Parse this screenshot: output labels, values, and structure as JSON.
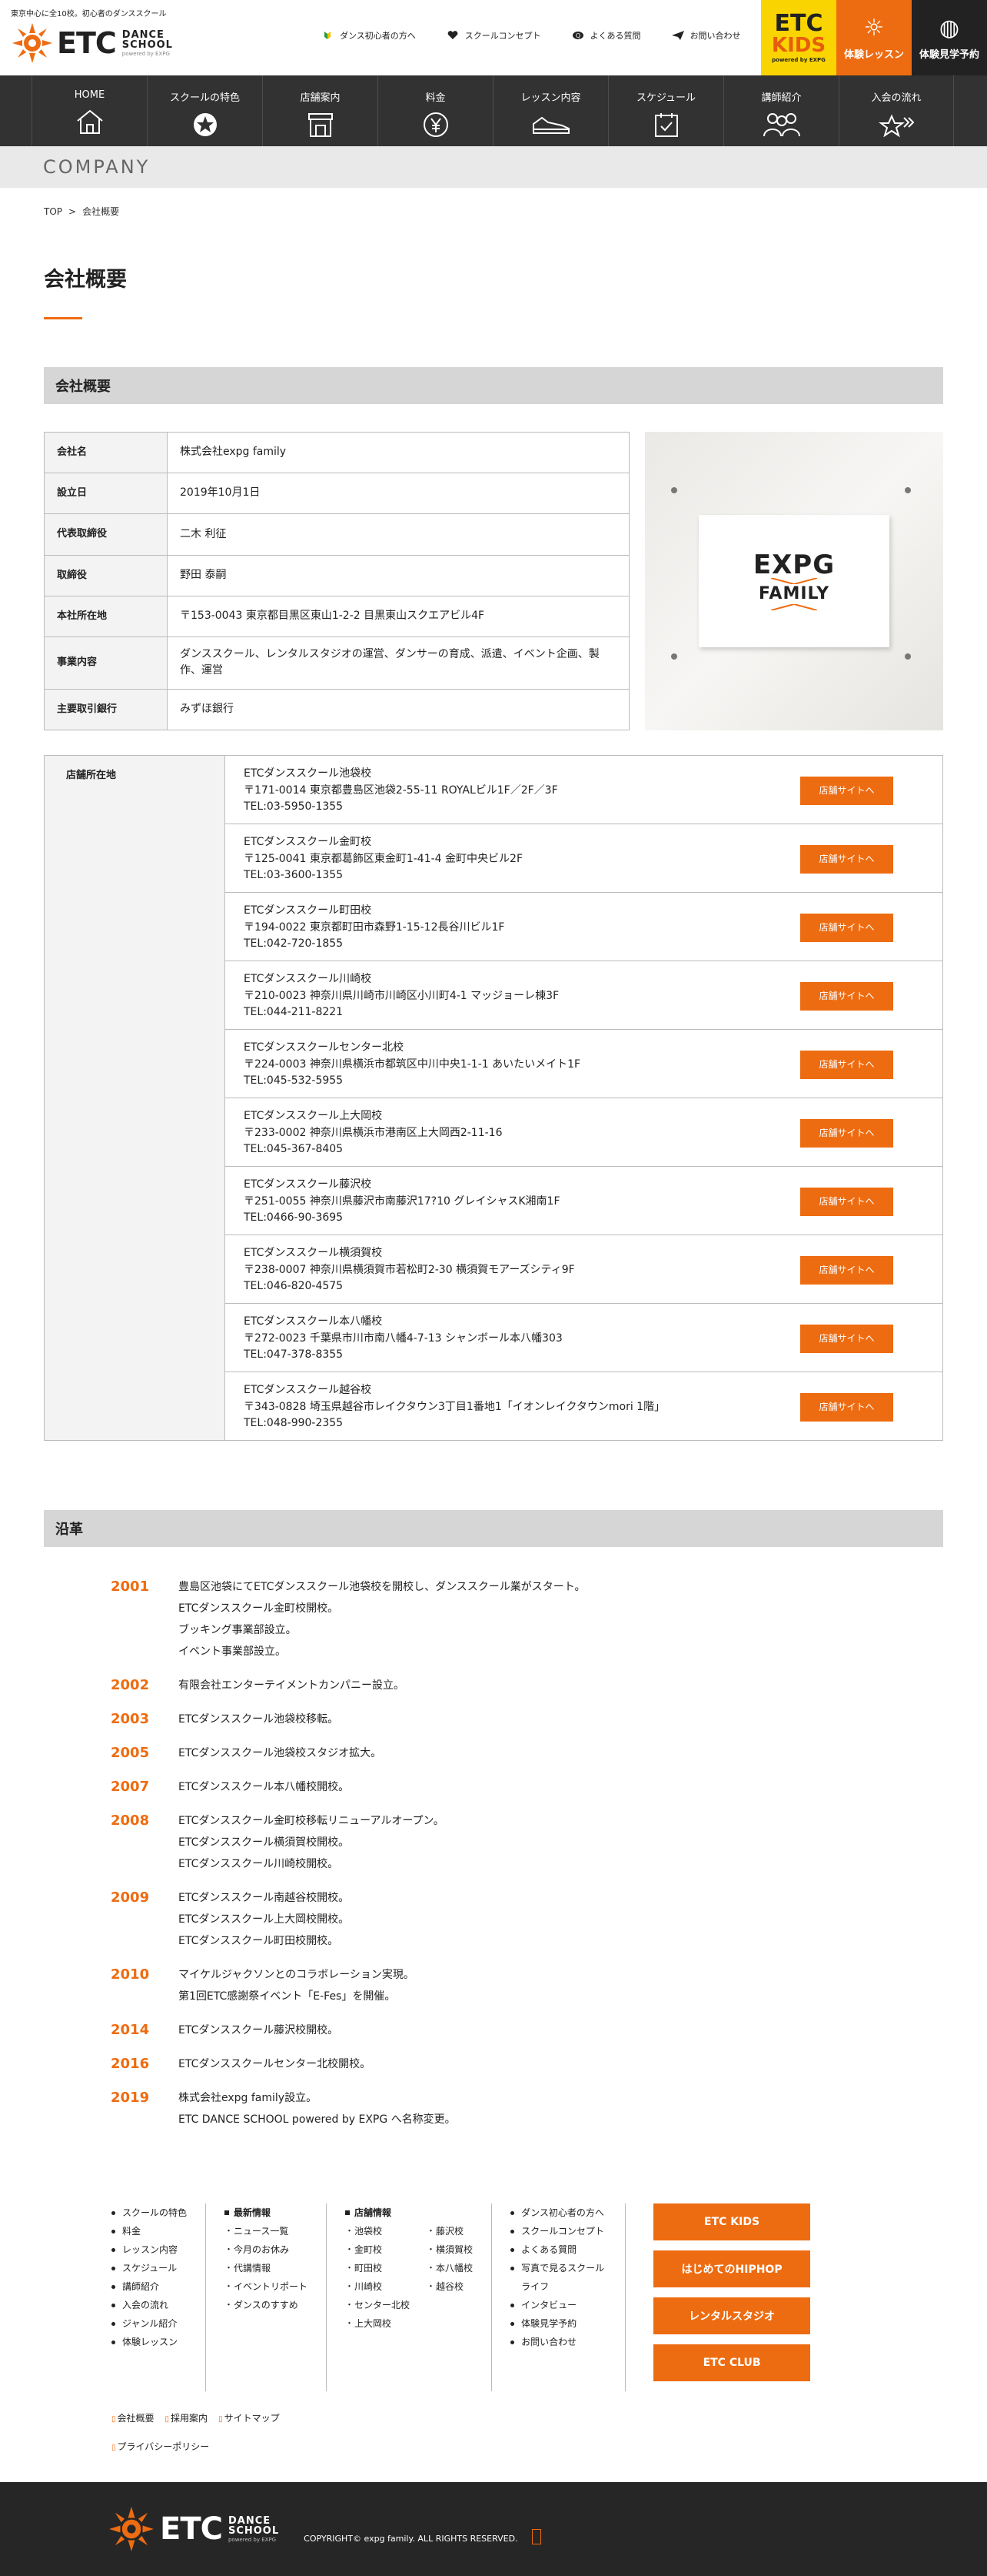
{
  "header": {
    "tagline": "東京中心に全10校。初心者のダンススクール",
    "logo_text": "ETC",
    "logo_sub1": "DANCE",
    "logo_sub2": "SCHOOL",
    "logo_sub3": "powered by EXPG",
    "top_nav": [
      {
        "label": "ダンス初心者の方へ",
        "icon": "beginner-mark-icon"
      },
      {
        "label": "スクールコンセプト",
        "icon": "heart-hands-icon"
      },
      {
        "label": "よくある質問",
        "icon": "question-bubble-icon"
      },
      {
        "label": "お問い合わせ",
        "icon": "paper-plane-icon"
      }
    ],
    "kids_line1": "ETC",
    "kids_line2": "KIDS",
    "kids_line3": "powered by EXPG",
    "trial_label": "体験レッスン",
    "visit_label": "体験見学予約"
  },
  "main_nav": [
    {
      "label": "HOME",
      "icon": "house-icon"
    },
    {
      "label": "スクールの特色",
      "icon": "badge-star-icon"
    },
    {
      "label": "店舗案内",
      "icon": "storefront-icon"
    },
    {
      "label": "料金",
      "icon": "yen-coin-icon"
    },
    {
      "label": "レッスン内容",
      "icon": "sneaker-icon"
    },
    {
      "label": "スケジュール",
      "icon": "calendar-check-icon"
    },
    {
      "label": "講師紹介",
      "icon": "people-icon"
    },
    {
      "label": "入会の流れ",
      "icon": "stars-flow-icon"
    }
  ],
  "band_title": "COMPANY",
  "breadcrumb": [
    "TOP",
    "会社概要"
  ],
  "page_title": "会社概要",
  "company_section_title": "会社概要",
  "company_info": [
    {
      "key": "会社名",
      "value": "株式会社expg family"
    },
    {
      "key": "設立日",
      "value": "2019年10月1日"
    },
    {
      "key": "代表取締役",
      "value": "二木 利征"
    },
    {
      "key": "取締役",
      "value": "野田 泰嗣"
    },
    {
      "key": "本社所在地",
      "value": "〒153-0043 東京都目黒区東山1-2-2 目黒東山スクエアビル4F"
    },
    {
      "key": "事業内容",
      "value": "ダンススクール、レンタルスタジオの運営、ダンサーの育成、派遣、イベント企画、製作、運営"
    },
    {
      "key": "主要取引銀行",
      "value": "みずほ銀行"
    }
  ],
  "sign": {
    "line1": "EXPG",
    "line2": "FAMILY"
  },
  "stores_key": "店舗所在地",
  "store_button_label": "店舗サイトへ",
  "stores": [
    {
      "name": "ETCダンススクール池袋校",
      "address": "〒171-0014 東京都豊島区池袋2-55-11 ROYALビル1F／2F／3F",
      "tel": "TEL:03-5950-1355"
    },
    {
      "name": "ETCダンススクール金町校",
      "address": "〒125-0041 東京都葛飾区東金町1-41-4 金町中央ビル2F",
      "tel": "TEL:03-3600-1355"
    },
    {
      "name": "ETCダンススクール町田校",
      "address": "〒194-0022 東京都町田市森野1-15-12長谷川ビル1F",
      "tel": "TEL:042-720-1855"
    },
    {
      "name": "ETCダンススクール川崎校",
      "address": "〒210-0023 神奈川県川崎市川崎区小川町4-1 マッジョーレ棟3F",
      "tel": "TEL:044-211-8221"
    },
    {
      "name": "ETCダンススクールセンター北校",
      "address": "〒224-0003 神奈川県横浜市都筑区中川中央1-1-1 あいたいメイト1F",
      "tel": "TEL:045-532-5955"
    },
    {
      "name": "ETCダンススクール上大岡校",
      "address": "〒233-0002 神奈川県横浜市港南区上大岡西2-11-16",
      "tel": "TEL:045-367-8405"
    },
    {
      "name": "ETCダンススクール藤沢校",
      "address": "〒251-0055 神奈川県藤沢市南藤沢17?10 グレイシャスK湘南1F",
      "tel": "TEL:0466-90-3695"
    },
    {
      "name": "ETCダンススクール横須賀校",
      "address": "〒238-0007 神奈川県横須賀市若松町2-30 横須賀モアーズシティ9F",
      "tel": "TEL:046-820-4575"
    },
    {
      "name": "ETCダンススクール本八幡校",
      "address": "〒272-0023 千葉県市川市南八幡4-7-13 シャンボール本八幡303",
      "tel": "TEL:047-378-8355"
    },
    {
      "name": "ETCダンススクール越谷校",
      "address": "〒343-0828 埼玉県越谷市レイクタウン3丁目1番地1「イオンレイクタウンmori 1階」",
      "tel": "TEL:048-990-2355"
    }
  ],
  "history_title": "沿革",
  "history": [
    {
      "year": "2001",
      "events": [
        "豊島区池袋にてETCダンススクール池袋校を開校し、ダンススクール業がスタート。",
        "ETCダンススクール金町校開校。",
        "ブッキング事業部設立。",
        "イベント事業部設立。"
      ]
    },
    {
      "year": "2002",
      "events": [
        "有限会社エンターテイメントカンパニー設立。"
      ]
    },
    {
      "year": "2003",
      "events": [
        "ETCダンススクール池袋校移転。"
      ]
    },
    {
      "year": "2005",
      "events": [
        "ETCダンススクール池袋校スタジオ拡大。"
      ]
    },
    {
      "year": "2007",
      "events": [
        "ETCダンススクール本八幡校開校。"
      ]
    },
    {
      "year": "2008",
      "events": [
        "ETCダンススクール金町校移転リニューアルオープン。",
        "ETCダンススクール横須賀校開校。",
        "ETCダンススクール川崎校開校。"
      ]
    },
    {
      "year": "2009",
      "events": [
        "ETCダンススクール南越谷校開校。",
        "ETCダンススクール上大岡校開校。",
        "ETCダンススクール町田校開校。"
      ]
    },
    {
      "year": "2010",
      "events": [
        "マイケルジャクソンとのコラボレーション実現。",
        "第1回ETC感謝祭イベント「E-Fes」を開催。"
      ]
    },
    {
      "year": "2014",
      "events": [
        "ETCダンススクール藤沢校開校。"
      ]
    },
    {
      "year": "2016",
      "events": [
        "ETCダンススクールセンター北校開校。"
      ]
    },
    {
      "year": "2019",
      "events": [
        "株式会社expg family設立。",
        "ETC DANCE SCHOOL powered by EXPG へ名称変更。"
      ]
    }
  ],
  "footer": {
    "col1": [
      "スクールの特色",
      "料金",
      "レッスン内容",
      "スケジュール",
      "講師紹介",
      "入会の流れ",
      "ジャンル紹介",
      "体験レッスン"
    ],
    "col2_title": "最新情報",
    "col2": [
      "ニュース一覧",
      "今月のお休み",
      "代講情報",
      "イベントリポート",
      "ダンスのすすめ"
    ],
    "col3_title": "店舗情報",
    "col3a": [
      "池袋校",
      "金町校",
      "町田校",
      "川崎校",
      "センター北校",
      "上大岡校"
    ],
    "col3b": [
      "藤沢校",
      "横須賀校",
      "本八幡校",
      "越谷校"
    ],
    "col4": [
      "ダンス初心者の方へ",
      "スクールコンセプト",
      "よくある質問",
      "写真で見るスクールライフ",
      "インタビュー",
      "体験見学予約",
      "お問い合わせ"
    ],
    "buttons": [
      "ETC KIDS",
      "はじめてのHIPHOP",
      "レンタルスタジオ",
      "ETC CLUB"
    ],
    "sub_links": [
      "会社概要",
      "採用案内",
      "サイトマップ"
    ],
    "privacy": "プライバシーポリシー",
    "copyright": "COPYRIGHT© expg family. ALL RIGHTS RESERVED."
  },
  "colors": {
    "accent": "#ee6c11",
    "kids_yellow": "#f9d400",
    "nav_dark": "#323232",
    "footer_dark": "#262626"
  }
}
